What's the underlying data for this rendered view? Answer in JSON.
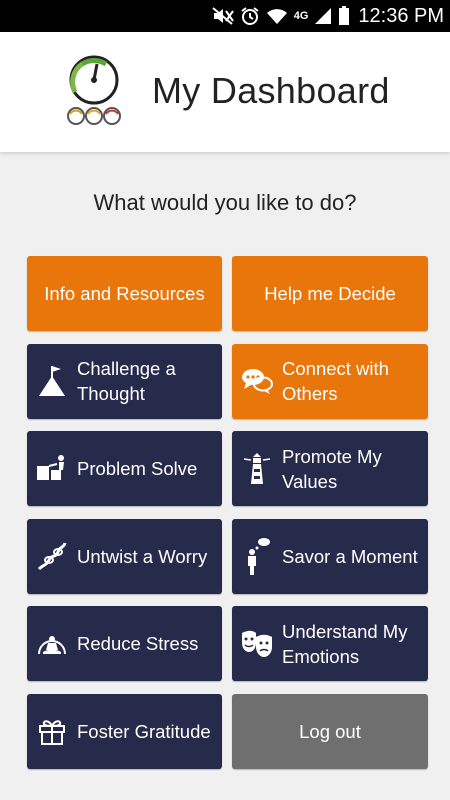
{
  "status_bar": {
    "network": "4G",
    "time": "12:36 PM",
    "icons": [
      "mute-icon",
      "alarm-icon",
      "wifi-icon",
      "signal-icon",
      "battery-icon"
    ]
  },
  "header": {
    "title": "My Dashboard",
    "logo": "dashboard-gauge-logo"
  },
  "prompt": "What would you like to do?",
  "tiles": [
    {
      "label": "Info and Resources",
      "color": "#e8760a",
      "icon": null
    },
    {
      "label": "Help me Decide",
      "color": "#e8760a",
      "icon": null
    },
    {
      "label": "Challenge a Thought",
      "color": "#262b4c",
      "icon": "summit-flag-icon"
    },
    {
      "label": "Connect with Others",
      "color": "#e8760a",
      "icon": "chat-bubbles-icon"
    },
    {
      "label": "Problem Solve",
      "color": "#262b4c",
      "icon": "person-blocks-icon"
    },
    {
      "label": "Promote My Values",
      "color": "#262b4c",
      "icon": "lighthouse-icon"
    },
    {
      "label": "Untwist a Worry",
      "color": "#262b4c",
      "icon": "twisted-rope-icon"
    },
    {
      "label": "Savor a Moment",
      "color": "#262b4c",
      "icon": "person-thought-icon"
    },
    {
      "label": "Reduce Stress",
      "color": "#262b4c",
      "icon": "meditation-icon"
    },
    {
      "label": "Understand My Emotions",
      "color": "#262b4c",
      "icon": "theater-masks-icon"
    },
    {
      "label": "Foster Gratitude",
      "color": "#262b4c",
      "icon": "gift-icon"
    },
    {
      "label": "Log out",
      "color": "#6f6f6f",
      "icon": null
    }
  ]
}
